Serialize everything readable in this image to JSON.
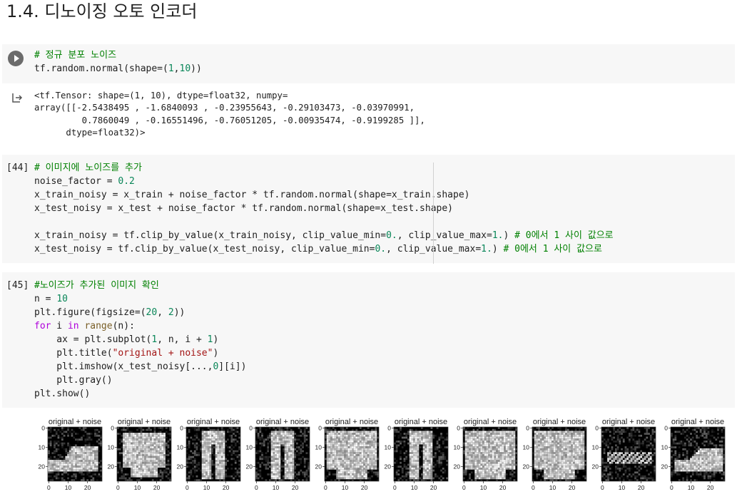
{
  "heading": "1.4. 디노이징 오토 인코더",
  "cell1": {
    "comment": "# 정규 분포 노이즈",
    "code_pre": "tf.random.normal(shape=(",
    "num_1": "1",
    "comma": ",",
    "num_10": "10",
    "code_post": "))"
  },
  "output1": {
    "lines": [
      "<tf.Tensor: shape=(1, 10), dtype=float32, numpy=",
      "array([[-2.5438495 , -1.6840093 , -0.23955643, -0.29103473, -0.03970991,",
      "         0.7860049 , -0.16551496, -0.76051205, -0.00935474, -0.9199285 ]],",
      "      dtype=float32)>"
    ]
  },
  "cell44": {
    "count": "[44]",
    "comment": "# 이미지에 노이즈를 추가",
    "l2a": "noise_factor = ",
    "l2b": "0.2",
    "l3": "x_train_noisy = x_train + noise_factor * tf.random.normal(shape=x_train.shape)",
    "l4": "x_test_noisy = x_test + noise_factor * tf.random.normal(shape=x_test.shape)",
    "l6a": "x_train_noisy = tf.clip_by_value(x_train_noisy, clip_value_min=",
    "l6b": "0.",
    "l6c": ", clip_value_max=",
    "l6d": "1.",
    "l6e": ") ",
    "l6f": "# 0에서 1 사이 값으로",
    "l7a": "x_test_noisy = tf.clip_by_value(x_test_noisy, clip_value_min=",
    "l7b": "0.",
    "l7c": ", clip_value_max=",
    "l7d": "1.",
    "l7e": ") ",
    "l7f": "# 0에서 1 사이 값으로"
  },
  "cell45": {
    "count": "[45]",
    "comment": "#노이즈가 추가된 이미지 확인",
    "l2a": "n = ",
    "l2b": "10",
    "l3a": "plt.figure(figsize=(",
    "l3b": "20",
    "l3c": ", ",
    "l3d": "2",
    "l3e": "))",
    "l4a": "for",
    "l4b": " i ",
    "l4c": "in",
    "l4d": " ",
    "l4e": "range",
    "l4f": "(n):",
    "l5a": "    ax = plt.subplot(",
    "l5b": "1",
    "l5c": ", n, i + ",
    "l5d": "1",
    "l5e": ")",
    "l6a": "    plt.title(",
    "l6b": "\"original + noise\"",
    "l6c": ")",
    "l7a": "    plt.imshow(x_test_noisy[...,",
    "l7b": "0",
    "l7c": "][i])",
    "l8": "    plt.gray()",
    "l9": "plt.show()"
  },
  "figure": {
    "subplot_title": "original + noise",
    "y_ticks": [
      "0",
      "10",
      "20"
    ],
    "x_ticks": [
      "0",
      "10",
      "20"
    ],
    "images": [
      "ankle-boot",
      "pullover",
      "trouser",
      "trouser",
      "shirt",
      "trouser",
      "coat",
      "shirt",
      "sandal",
      "sneaker"
    ]
  }
}
